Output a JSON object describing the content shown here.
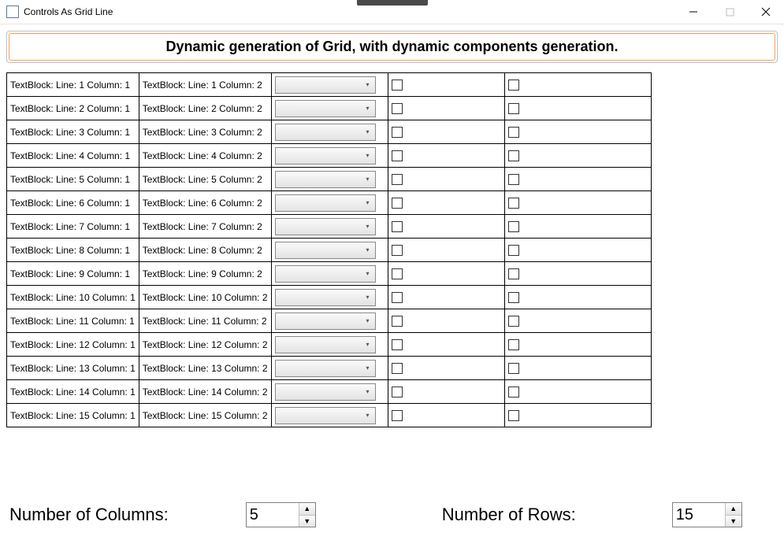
{
  "window": {
    "title": "Controls As Grid Line"
  },
  "header": {
    "text": "Dynamic generation of Grid, with dynamic components generation."
  },
  "grid": {
    "rows": [
      {
        "col1": "TextBlock: Line: 1 Column: 1",
        "col2": "TextBlock: Line: 1 Column: 2"
      },
      {
        "col1": "TextBlock: Line: 2 Column: 1",
        "col2": "TextBlock: Line: 2 Column: 2"
      },
      {
        "col1": "TextBlock: Line: 3 Column: 1",
        "col2": "TextBlock: Line: 3 Column: 2"
      },
      {
        "col1": "TextBlock: Line: 4 Column: 1",
        "col2": "TextBlock: Line: 4 Column: 2"
      },
      {
        "col1": "TextBlock: Line: 5 Column: 1",
        "col2": "TextBlock: Line: 5 Column: 2"
      },
      {
        "col1": "TextBlock: Line: 6 Column: 1",
        "col2": "TextBlock: Line: 6 Column: 2"
      },
      {
        "col1": "TextBlock: Line: 7 Column: 1",
        "col2": "TextBlock: Line: 7 Column: 2"
      },
      {
        "col1": "TextBlock: Line: 8 Column: 1",
        "col2": "TextBlock: Line: 8 Column: 2"
      },
      {
        "col1": "TextBlock: Line: 9 Column: 1",
        "col2": "TextBlock: Line: 9 Column: 2"
      },
      {
        "col1": "TextBlock: Line: 10 Column: 1",
        "col2": "TextBlock: Line: 10 Column: 2"
      },
      {
        "col1": "TextBlock: Line: 11 Column: 1",
        "col2": "TextBlock: Line: 11 Column: 2"
      },
      {
        "col1": "TextBlock: Line: 12 Column: 1",
        "col2": "TextBlock: Line: 12 Column: 2"
      },
      {
        "col1": "TextBlock: Line: 13 Column: 1",
        "col2": "TextBlock: Line: 13 Column: 2"
      },
      {
        "col1": "TextBlock: Line: 14 Column: 1",
        "col2": "TextBlock: Line: 14 Column: 2"
      },
      {
        "col1": "TextBlock: Line: 15 Column: 1",
        "col2": "TextBlock: Line: 15 Column: 2"
      }
    ]
  },
  "footer": {
    "columns_label": "Number of Columns:",
    "columns_value": "5",
    "rows_label": "Number of Rows:",
    "rows_value": "15"
  }
}
